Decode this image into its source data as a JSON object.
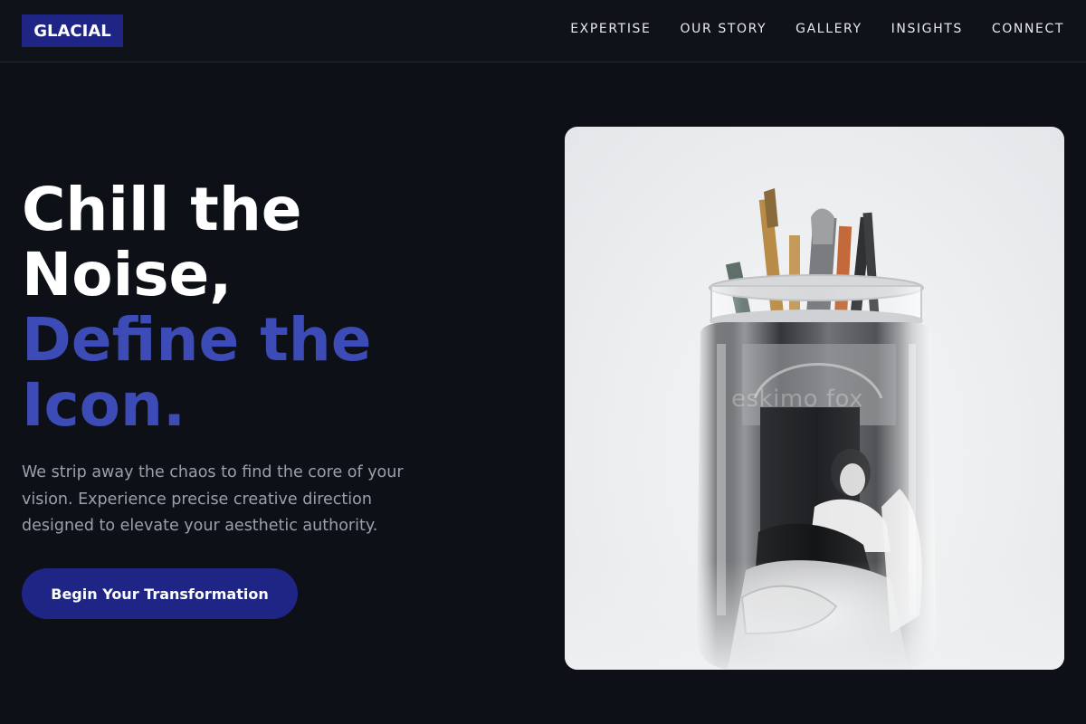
{
  "brand": {
    "logo_text": "GLACIAL"
  },
  "nav": {
    "links": [
      {
        "label": "EXPERTISE"
      },
      {
        "label": "OUR STORY"
      },
      {
        "label": "GALLERY"
      },
      {
        "label": "INSIGHTS"
      },
      {
        "label": "CONNECT"
      }
    ]
  },
  "hero": {
    "title_line1": "Chill the",
    "title_line2": "Noise,",
    "title_accent_line1": "Define the",
    "title_accent_line2": "Icon.",
    "description": "We strip away the chaos to find the core of your vision. Experience precise creative direction designed to elevate your aesthetic authority.",
    "cta_label": "Begin Your Transformation",
    "image_watermark": "eskimo fox"
  },
  "colors": {
    "background": "#0d1017",
    "accent": "#3d4bb6",
    "button": "#1e2585",
    "muted_text": "#9aa0ab"
  }
}
